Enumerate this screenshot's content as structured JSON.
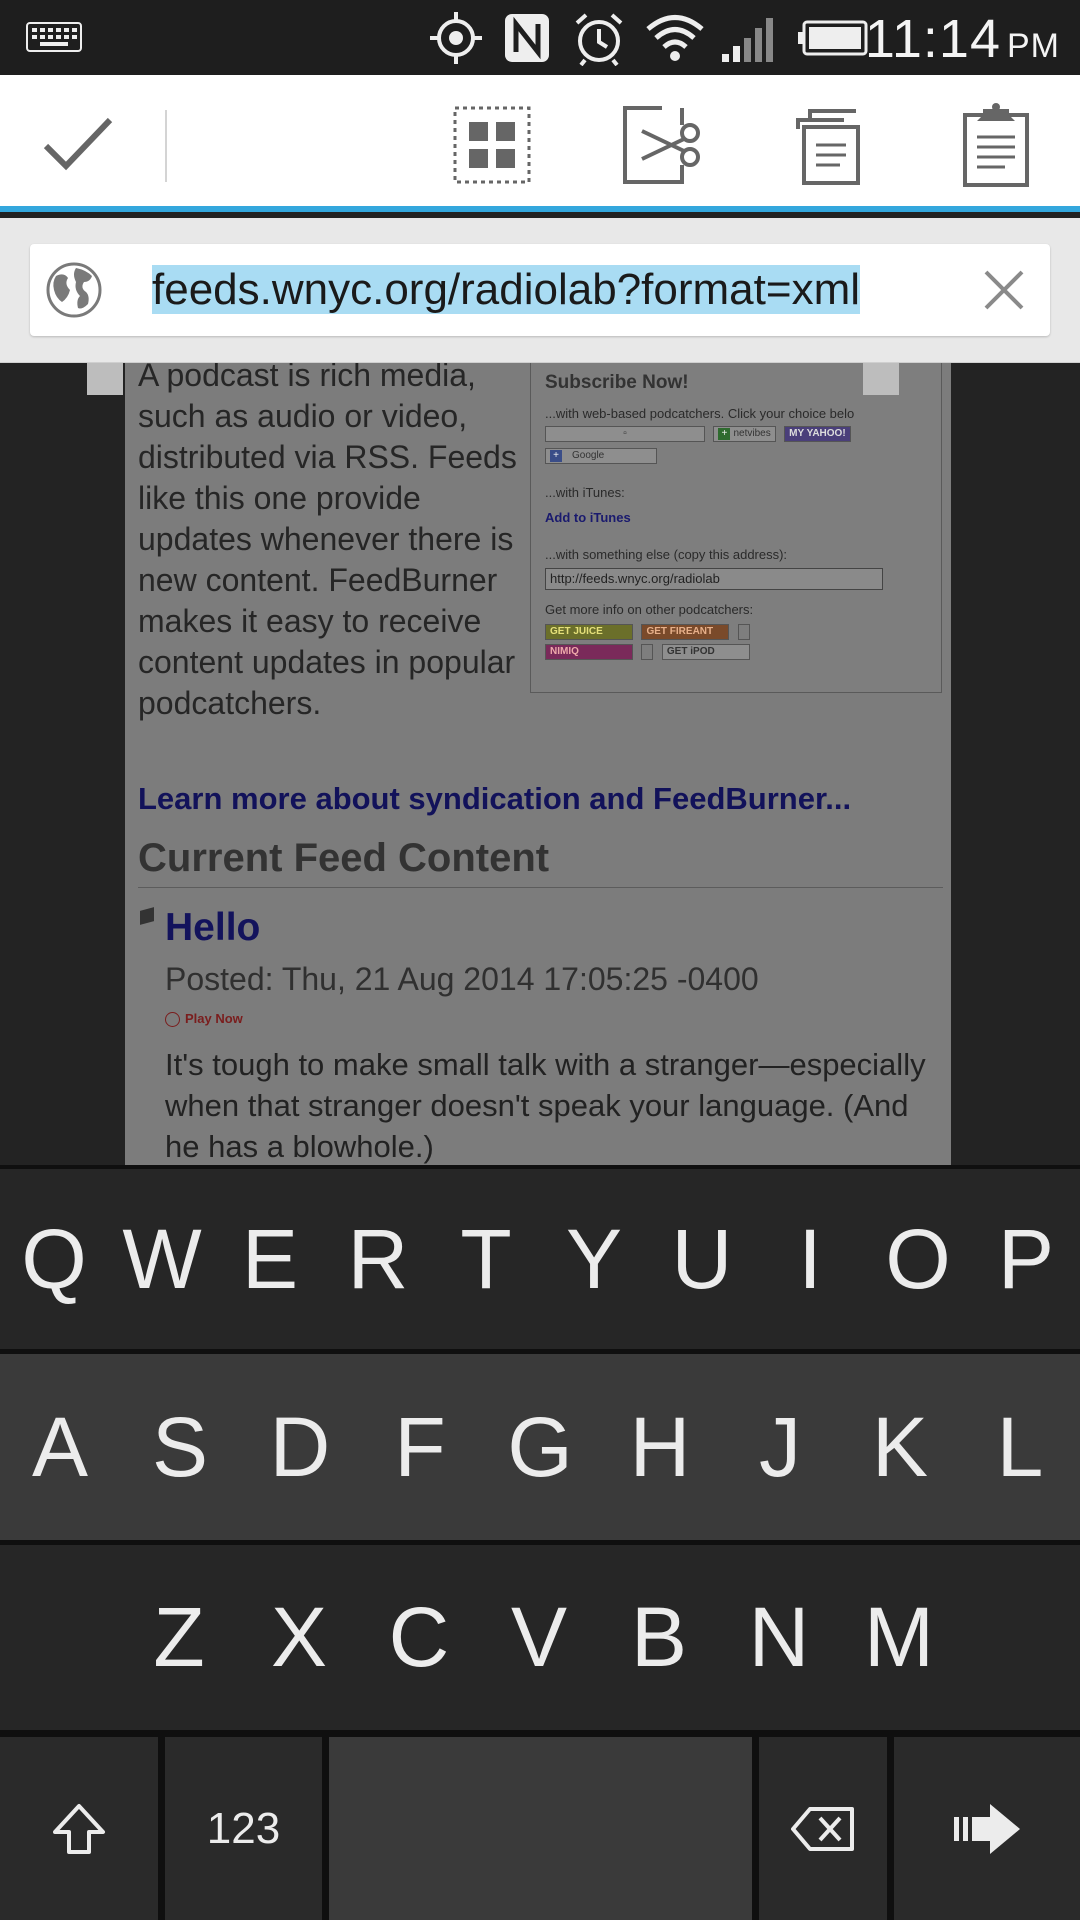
{
  "status_bar": {
    "time": "11:14",
    "ampm": "PM",
    "icons": [
      "keyboard-icon",
      "location-icon",
      "nfc-icon",
      "alarm-icon",
      "wifi-icon",
      "signal-icon",
      "battery-icon"
    ]
  },
  "action_bar": {
    "buttons": [
      "done-check-icon",
      "select-all-icon",
      "cut-icon",
      "copy-icon",
      "paste-icon"
    ]
  },
  "url_bar": {
    "url": "feeds.wnyc.org/radiolab?format=xml",
    "accent_color": "#33a7dd",
    "selection_color": "#a9dcf3"
  },
  "page": {
    "intro": "A podcast is rich media, such as audio or video, distributed via RSS. Feeds like this one provide updates whenever there is new content. FeedBurner makes it easy to receive content updates in popular podcatchers.",
    "subscribe": {
      "title": "Subscribe Now!",
      "web_based": "...with web-based podcatchers. Click your choice belo",
      "netvibes": "netvibes",
      "myyahoo": "MY YAHOO!",
      "google": "Google",
      "itunes_label": "...with iTunes:",
      "itunes_link": "Add to iTunes",
      "else_label": "...with something else (copy this address):",
      "address": "http://feeds.wnyc.org/radiolab",
      "more_info": "Get more info on other podcatchers:",
      "getjuice": "GET JUICE",
      "getfireant": "GET FIREANT",
      "nimiq": "NIMIQ",
      "getipod": "GET iPOD"
    },
    "learn_more": "Learn more about syndication and FeedBurner...",
    "feed_heading": "Current Feed Content",
    "item": {
      "title": "Hello",
      "posted": "Posted: Thu, 21 Aug 2014 17:05:25 -0400",
      "play": "Play Now",
      "description": "It's tough to make small talk with a stranger—especially when that stranger doesn't speak your language. (And he has a blowhole.)"
    }
  },
  "keyboard": {
    "row1": [
      "Q",
      "W",
      "E",
      "R",
      "T",
      "Y",
      "U",
      "I",
      "O",
      "P"
    ],
    "row2": [
      "A",
      "S",
      "D",
      "F",
      "G",
      "H",
      "J",
      "K",
      "L"
    ],
    "row3": [
      "Z",
      "X",
      "C",
      "V",
      "B",
      "N",
      "M"
    ],
    "numbers_label": "123",
    "bottom_icons": [
      "shift-icon",
      "backspace-icon",
      "enter-arrow-icon"
    ]
  }
}
